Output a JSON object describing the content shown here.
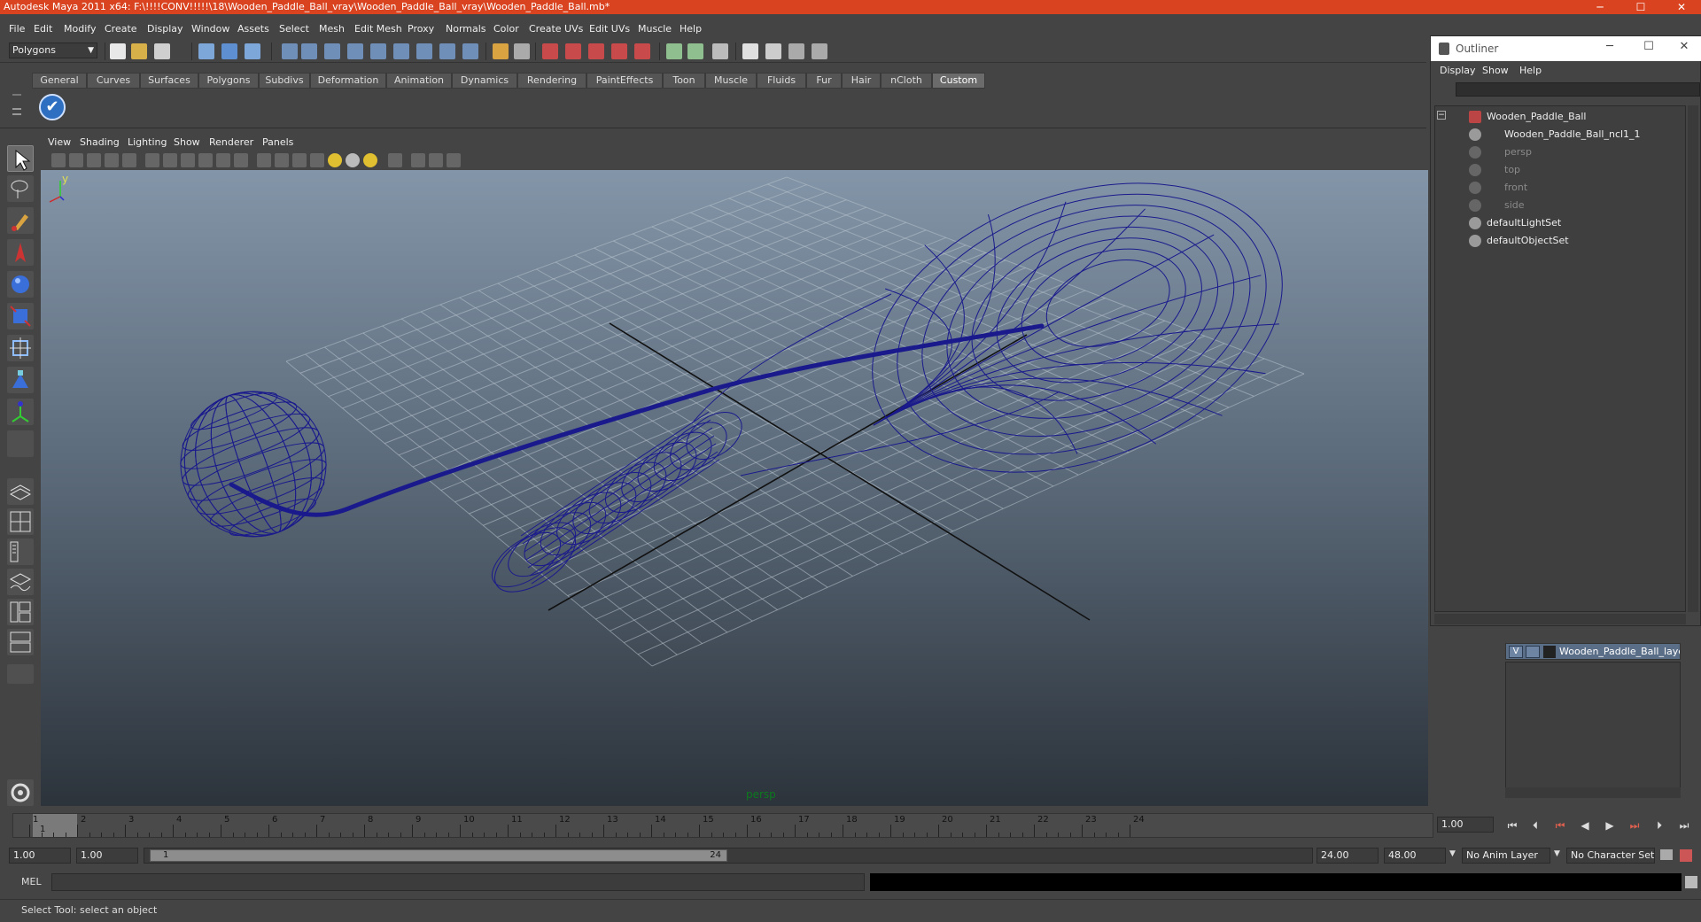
{
  "window": {
    "title": "Autodesk Maya 2011 x64: F:\\!!!!CONV!!!!!\\18\\Wooden_Paddle_Ball_vray\\Wooden_Paddle_Ball_vray\\Wooden_Paddle_Ball.mb*",
    "min": "─",
    "max": "☐",
    "close": "✕"
  },
  "menubar": [
    "File",
    "Edit",
    "Modify",
    "Create",
    "Display",
    "Window",
    "Assets",
    "Select",
    "Mesh",
    "Edit Mesh",
    "Proxy",
    "Normals",
    "Color",
    "Create UVs",
    "Edit UVs",
    "Muscle",
    "Help"
  ],
  "statusline": {
    "mode": "Polygons"
  },
  "shelf": {
    "tabs": [
      "General",
      "Curves",
      "Surfaces",
      "Polygons",
      "Subdivs",
      "Deformation",
      "Animation",
      "Dynamics",
      "Rendering",
      "PaintEffects",
      "Toon",
      "Muscle",
      "Fluids",
      "Fur",
      "Hair",
      "nCloth",
      "Custom"
    ],
    "active": "Custom",
    "check_glyph": "✔"
  },
  "viewport": {
    "menu": [
      "View",
      "Shading",
      "Lighting",
      "Show",
      "Renderer",
      "Panels"
    ],
    "camera": "persp",
    "axis_y": "y",
    "wire_color": "#1b1a8c"
  },
  "outliner": {
    "title": "Outliner",
    "menu": [
      "Display",
      "Show",
      "Help"
    ],
    "items": [
      {
        "label": "Wooden_Paddle_Ball",
        "dim": false
      },
      {
        "label": "Wooden_Paddle_Ball_ncl1_1",
        "dim": false
      },
      {
        "label": "persp",
        "dim": true
      },
      {
        "label": "top",
        "dim": true
      },
      {
        "label": "front",
        "dim": true
      },
      {
        "label": "side",
        "dim": true
      },
      {
        "label": "defaultLightSet",
        "dim": false
      },
      {
        "label": "defaultObjectSet",
        "dim": false
      }
    ]
  },
  "layers": {
    "visible_flag": "V",
    "name": "Wooden_Paddle_Ball_layer"
  },
  "timeline": {
    "ticks": [
      "1",
      "2",
      "3",
      "4",
      "5",
      "6",
      "7",
      "8",
      "9",
      "10",
      "11",
      "12",
      "13",
      "14",
      "15",
      "16",
      "17",
      "18",
      "19",
      "20",
      "21",
      "22",
      "23",
      "24"
    ],
    "current": "1",
    "current_field": "1.00"
  },
  "playback": {
    "buttons": [
      "⏮",
      "⏴⏴",
      "⏮",
      "◀",
      "▶",
      "⏭",
      "⏵⏵",
      "⏭"
    ]
  },
  "range": {
    "start_field": "1.00",
    "start_playback": "1.00",
    "slider_start": "1",
    "slider_end": "24",
    "end_playback": "24.00",
    "end_field": "48.00",
    "anim_layer": "No Anim Layer",
    "char_set": "No Character Set"
  },
  "cmdline": {
    "label": "MEL"
  },
  "helpline": {
    "text": "Select Tool: select an object"
  }
}
